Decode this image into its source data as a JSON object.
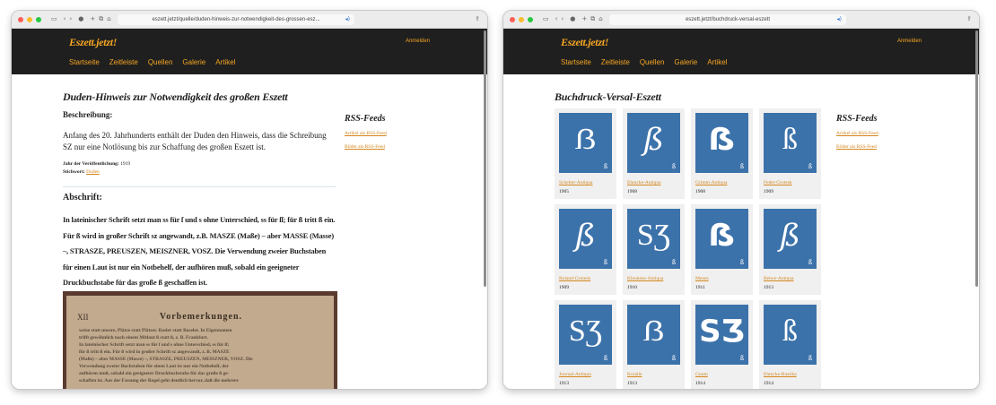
{
  "browser1": {
    "url": "eszett.jetzt/quelle/duden-hinweis-zur-notwendigkeit-des-grossen-esz..."
  },
  "browser2": {
    "url": "eszett.jetzt/buchdruck-versal-eszett"
  },
  "site": {
    "logo": "Eszett.jetzt!",
    "login": "Anmelden",
    "nav": [
      "Startseite",
      "Zeitleiste",
      "Quellen",
      "Galerie",
      "Artikel"
    ],
    "accent_color": "#f5a623",
    "header_color": "#1f1f1f"
  },
  "page1": {
    "title": "Duden-Hinweis zur Notwendigkeit des großen Eszett",
    "beschreibung_label": "Beschreibung:",
    "description": "Anfang des 20. Jahrhunderts enthält der Duden den Hinweis, dass die Schreibung SZ nur eine Notlösung bis zur Schaffung des großen Eszett ist.",
    "year_label": "Jahr der Veröffentlichung:",
    "year": "1919",
    "keyword_label": "Stichwort:",
    "keyword": "Duden",
    "abschrift_label": "Abschrift:",
    "abschrift": "In lateinischer Schrift setzt man ss für ſ und s ohne Unterschied, ss für ſſ; für ß tritt ß ein. Für ß wird in großer Schrift sz angewandt, z.B. MASZE (Maße) – aber MASSE (Masse) –, STRASZE, PREUSZEN, MEISZNER, VOSZ. Die Verwendung zweier Buchstaben für einen Laut ist nur ein Notbehelf, der aufhören muß, sobald ein geeigneter Druckbuchstabe für das große ß geschaffen ist.",
    "scan": {
      "page_number": "XII",
      "heading": "Vorbemerkungen.",
      "lines": [
        "weise statt unsere, Plätze statt Plätzer. Basler statt Baseler. In Eigennamen",
        "trifft gewöhnlich nach einem Mitlaut ß statt ß, z. B. Frankfurt.",
        "In lateinischer Schrift setzt man ss für ſ und s ohne Unterschied, ss für ſſ;",
        "für ß tritt ß ein. Für ß wird in großer Schrift sz angewandt, z. B. MASZE",
        "(Maße) – aber MASSE (Masse) –, STRASZE, PREUSZEN, MEISZNER, VOSZ. Die",
        "Verwendung zweier Buchstaben für einen Laut ist nur ein Notbehelf, der",
        "aufhören muß, sobald ein geeigneter Druckbuchstabe für das große ß ge-",
        "schaffen ist.    Aus der Fassung der Regel geht deutlich hervor, daß die mehrere"
      ]
    }
  },
  "sidebar": {
    "title": "RSS-Feeds",
    "links": [
      "Artikel als RSS-Feed",
      "Bilder als RSS-Feed"
    ]
  },
  "page2": {
    "title": "Buchdruck-Versal-Eszett",
    "cards": [
      {
        "name": "Schelter-Antiqua",
        "year": "1905",
        "glyph": "ẞ",
        "small": "ß",
        "style": "serifB"
      },
      {
        "name": "Ehmcke-Antiqua",
        "year": "1908",
        "glyph": "ß",
        "small": "ß",
        "style": "itB"
      },
      {
        "name": "Grimm-Antiqua",
        "year": "1908",
        "glyph": "ẞ",
        "small": "ß",
        "style": "boldB"
      },
      {
        "name": "Feder-Grotesk",
        "year": "1909",
        "glyph": "ß",
        "small": "ß",
        "style": "serifB"
      },
      {
        "name": "Roland-Grotesk",
        "year": "1909",
        "glyph": "ß",
        "small": "ß",
        "style": "itB"
      },
      {
        "name": "Kleukens-Antiqua",
        "year": "1910",
        "glyph": "SƷ",
        "small": "ß",
        "style": "serifB"
      },
      {
        "name": "Menes",
        "year": "1911",
        "glyph": "ẞ",
        "small": "ß",
        "style": "boldB"
      },
      {
        "name": "Belwe-Antiqua",
        "year": "1913",
        "glyph": "ß",
        "small": "ß",
        "style": "itB"
      },
      {
        "name": "Journal-Antiqua",
        "year": "1913",
        "glyph": "SƷ",
        "small": "ß",
        "style": "serifB"
      },
      {
        "name": "Koralle",
        "year": "1913",
        "glyph": "ẞ",
        "small": "ß",
        "style": "serifB"
      },
      {
        "name": "Gnom",
        "year": "1914",
        "glyph": "SƷ",
        "small": "ß",
        "style": "boldB"
      },
      {
        "name": "Ehmcke-Rustika",
        "year": "1914",
        "glyph": "ß",
        "small": "ß",
        "style": "serifB"
      }
    ],
    "tile_color": "#3c72aa"
  }
}
